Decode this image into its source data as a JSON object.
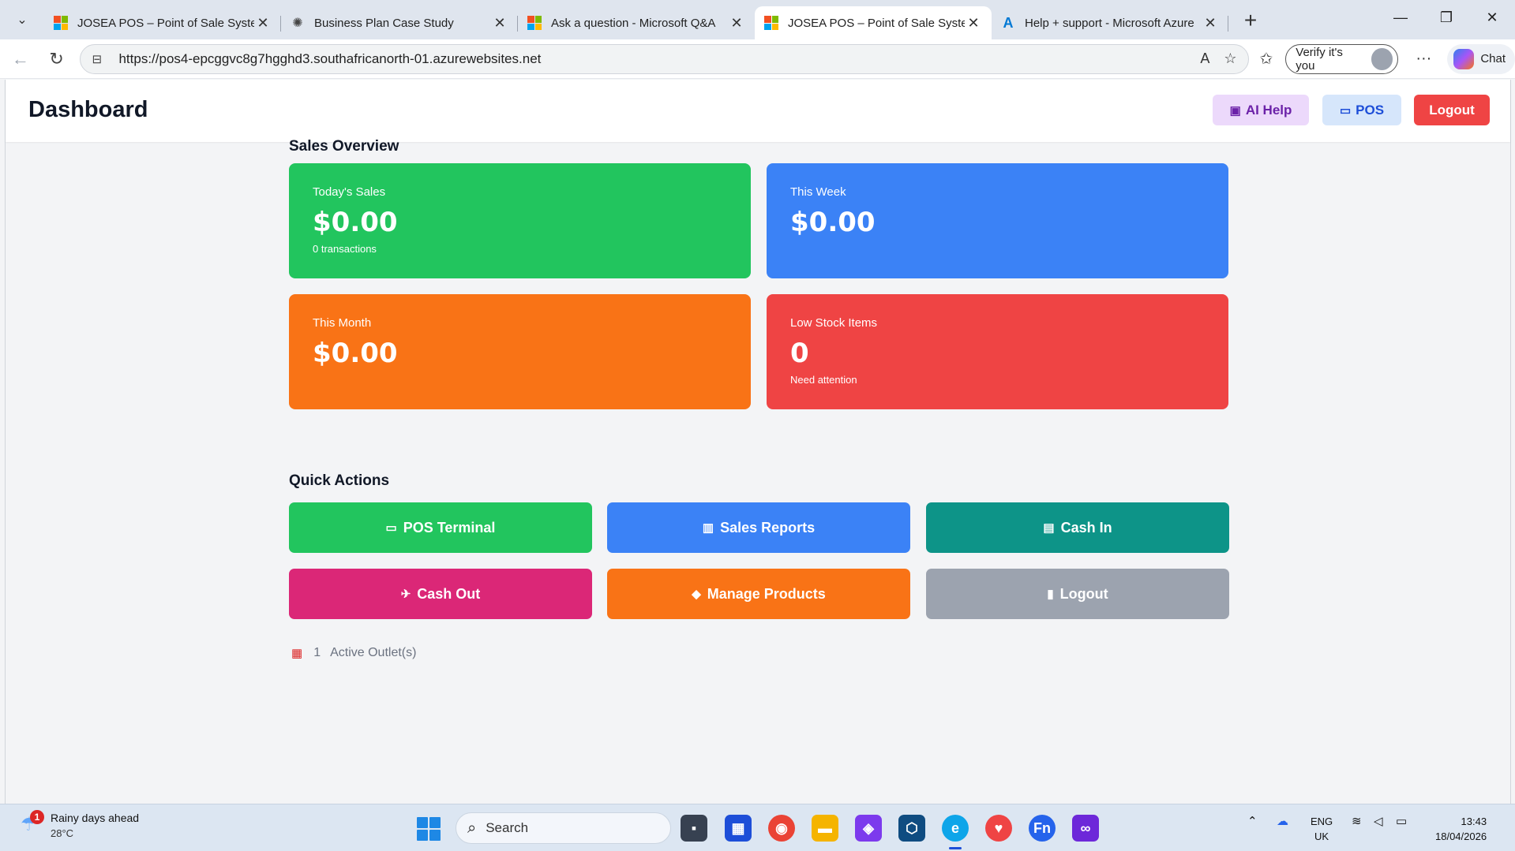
{
  "browser": {
    "tabs": [
      {
        "title": "JOSEA POS – Point of Sale System",
        "favicon": "microsoft-logo-icon",
        "active": false
      },
      {
        "title": "Business Plan Case Study",
        "favicon": "chatgpt-icon",
        "active": false
      },
      {
        "title": "Ask a question - Microsoft Q&A",
        "favicon": "microsoft-logo-icon",
        "active": false
      },
      {
        "title": "JOSEA POS – Point of Sale System",
        "favicon": "microsoft-logo-icon",
        "active": true
      },
      {
        "title": "Help + support - Microsoft Azure",
        "favicon": "azure-icon",
        "active": false
      }
    ],
    "url": "https://pos4-epcggvc8g7hgghd3.southafricanorth-01.azurewebsites.net",
    "verify_label": "Verify it's you",
    "chat_label": "Chat"
  },
  "header": {
    "title": "Dashboard",
    "ai_help_label": "AI Help",
    "pos_label": "POS",
    "logout_label": "Logout"
  },
  "sales_overview": {
    "title": "Sales Overview",
    "cards": [
      {
        "label": "Today's Sales",
        "value": "$0.00",
        "sub": "0 transactions",
        "color": "#22c55e"
      },
      {
        "label": "This Week",
        "value": "$0.00",
        "sub": "",
        "color": "#3b82f6"
      },
      {
        "label": "This Month",
        "value": "$0.00",
        "sub": "",
        "color": "#f97316"
      },
      {
        "label": "Low Stock Items",
        "value": "0",
        "sub": "Need attention",
        "color": "#ef4444"
      }
    ]
  },
  "quick_actions": {
    "title": "Quick Actions",
    "buttons": [
      {
        "label": "POS Terminal",
        "icon": "computer-icon",
        "color": "#22c55e"
      },
      {
        "label": "Sales Reports",
        "icon": "bar-chart-icon",
        "color": "#3b82f6"
      },
      {
        "label": "Cash In",
        "icon": "money-icon",
        "color": "#0d9488"
      },
      {
        "label": "Cash Out",
        "icon": "money-wings-icon",
        "color": "#db2777"
      },
      {
        "label": "Manage Products",
        "icon": "tag-icon",
        "color": "#f97316"
      },
      {
        "label": "Logout",
        "icon": "door-icon",
        "color": "#9ca3af"
      }
    ]
  },
  "outlets": {
    "count": "1",
    "label": "Active Outlet(s)"
  },
  "taskbar": {
    "weather_title": "Rainy days ahead",
    "weather_temp": "28°C",
    "weather_badge": "1",
    "search_placeholder": "Search",
    "lang_line1": "ENG",
    "lang_line2": "UK",
    "time": "13:43",
    "date": "18/04/2026"
  }
}
